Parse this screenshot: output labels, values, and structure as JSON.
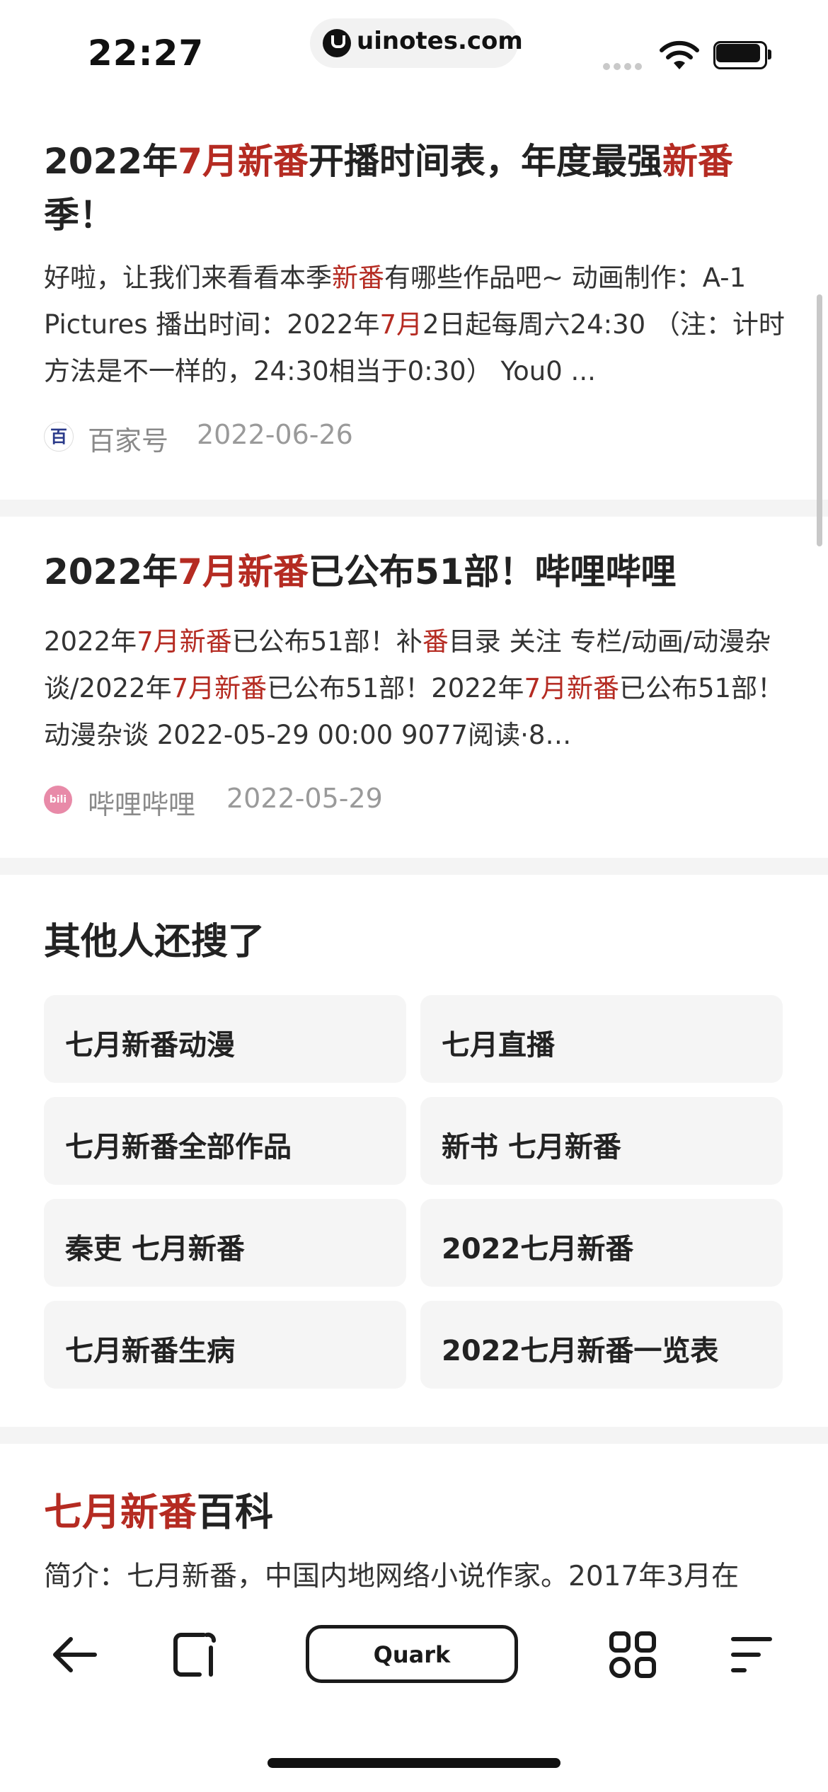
{
  "status_bar": {
    "time": "22:27",
    "url": "uinotes.com"
  },
  "results": [
    {
      "title_parts": [
        {
          "t": "2022年",
          "hl": false
        },
        {
          "t": "7月新番",
          "hl": true
        },
        {
          "t": "开播时间表，年度最强",
          "hl": false
        },
        {
          "t": "新番",
          "hl": true
        },
        {
          "t": "季！",
          "hl": false
        }
      ],
      "snippet_parts": [
        {
          "t": "好啦，让我们来看看本季",
          "hl": false
        },
        {
          "t": "新番",
          "hl": true
        },
        {
          "t": "有哪些作品吧~ 动画制作：A-1 Pictures 播出时间：2022年",
          "hl": false
        },
        {
          "t": "7月",
          "hl": true
        },
        {
          "t": "2日起每周六24:30 （注：计时方法是不一样的，24:30相当于0:30） You0 ...",
          "hl": false
        }
      ],
      "source": "百家号",
      "source_icon": "baidu-icon",
      "date": "2022-06-26"
    },
    {
      "title_parts": [
        {
          "t": "2022年",
          "hl": false
        },
        {
          "t": "7月新番",
          "hl": true
        },
        {
          "t": "已公布51部！哔哩哔哩",
          "hl": false
        }
      ],
      "snippet_parts": [
        {
          "t": "2022年",
          "hl": false
        },
        {
          "t": "7月新番",
          "hl": true
        },
        {
          "t": "已公布51部！补",
          "hl": false
        },
        {
          "t": "番",
          "hl": true
        },
        {
          "t": "目录 关注 专栏/动画/动漫杂谈/2022年",
          "hl": false
        },
        {
          "t": "7月新番",
          "hl": true
        },
        {
          "t": "已公布51部！2022年",
          "hl": false
        },
        {
          "t": "7月新番",
          "hl": true
        },
        {
          "t": "已公布51部！动漫杂谈 2022-05-29 00:00 9077阅读·8…",
          "hl": false
        }
      ],
      "source": "哔哩哔哩",
      "source_icon": "bilibili-icon",
      "date": "2022-05-29"
    }
  ],
  "related": {
    "title": "其他人还搜了",
    "items": [
      "七月新番动漫",
      "七月直播",
      "七月新番全部作品",
      "新书 七月新番",
      "秦吏 七月新番",
      "2022七月新番",
      "七月新番生病",
      "2022七月新番一览表"
    ]
  },
  "baike": {
    "title_hl": "七月新番",
    "title_rest": "百科",
    "snippet": "简介：七月新番，中国内地网络小说作家。2017年3月在"
  },
  "toolbar": {
    "quark_label": "Quark"
  },
  "colors": {
    "highlight": "#b52b22",
    "divider": "#f4f4f4",
    "chip": "#f5f5f5"
  }
}
